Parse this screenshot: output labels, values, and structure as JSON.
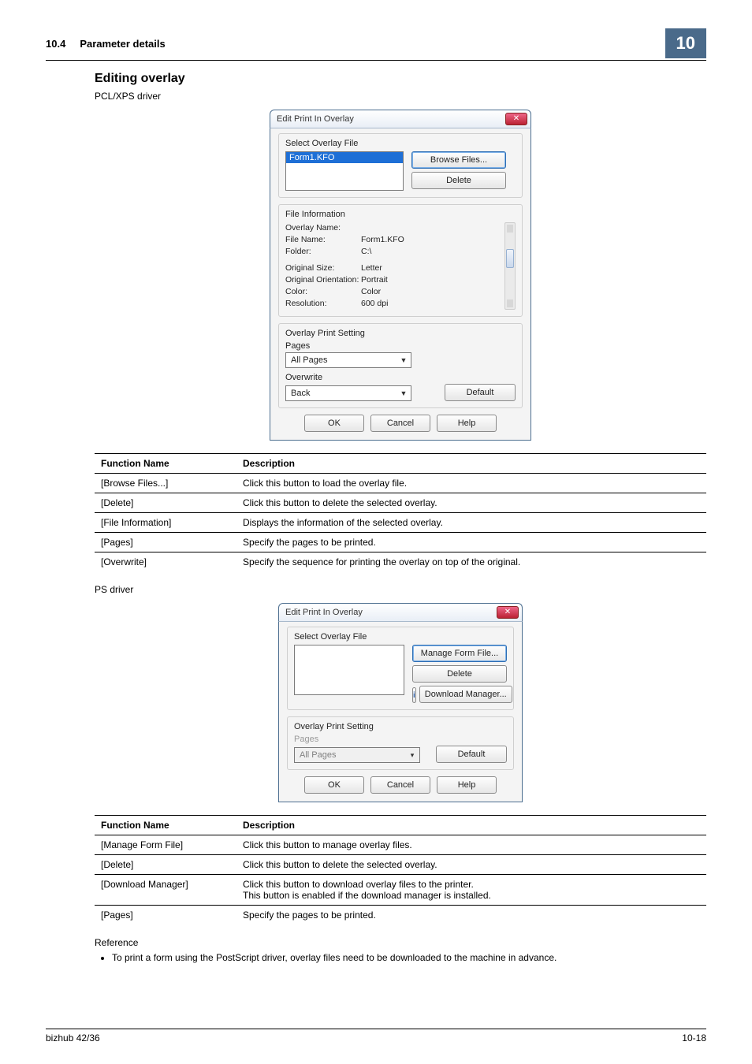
{
  "header": {
    "section_number": "10.4",
    "section_title": "Parameter details",
    "chapter": "10"
  },
  "editing": {
    "heading": "Editing overlay",
    "driver_pcl": "PCL/XPS driver",
    "driver_ps": "PS driver"
  },
  "dialog1": {
    "title": "Edit Print In Overlay",
    "select_label": "Select Overlay File",
    "selected_item": "Form1.KFO",
    "btn_browse": "Browse Files...",
    "btn_delete": "Delete",
    "file_info_label": "File Information",
    "kv": {
      "overlay_name_k": "Overlay Name:",
      "overlay_name_v": "",
      "file_name_k": "File Name:",
      "file_name_v": "Form1.KFO",
      "folder_k": "Folder:",
      "folder_v": "C:\\",
      "orig_size_k": "Original Size:",
      "orig_size_v": "Letter",
      "orig_orient_k": "Original Orientation:",
      "orig_orient_v": "Portrait",
      "color_k": "Color:",
      "color_v": "Color",
      "resolution_k": "Resolution:",
      "resolution_v": "600 dpi"
    },
    "ops_label": "Overlay Print Setting",
    "pages_label": "Pages",
    "pages_value": "All Pages",
    "overwrite_label": "Overwrite",
    "overwrite_value": "Back",
    "btn_default": "Default",
    "btn_ok": "OK",
    "btn_cancel": "Cancel",
    "btn_help": "Help"
  },
  "table1": {
    "h1": "Function Name",
    "h2": "Description",
    "rows": [
      {
        "f": "[Browse Files...]",
        "d": "Click this button to load the overlay file."
      },
      {
        "f": "[Delete]",
        "d": "Click this button to delete the selected overlay."
      },
      {
        "f": "[File Information]",
        "d": "Displays the information of the selected overlay."
      },
      {
        "f": "[Pages]",
        "d": "Specify the pages to be printed."
      },
      {
        "f": "[Overwrite]",
        "d": "Specify the sequence for printing the overlay on top of the original."
      }
    ]
  },
  "dialog2": {
    "title": "Edit Print In Overlay",
    "select_label": "Select Overlay File",
    "btn_manage": "Manage Form File...",
    "btn_delete": "Delete",
    "btn_download": "Download Manager...",
    "ops_label": "Overlay Print Setting",
    "pages_label": "Pages",
    "pages_value": "All Pages",
    "btn_default": "Default",
    "btn_ok": "OK",
    "btn_cancel": "Cancel",
    "btn_help": "Help"
  },
  "table2": {
    "h1": "Function Name",
    "h2": "Description",
    "rows": [
      {
        "f": "[Manage Form File]",
        "d": "Click this button to manage overlay files."
      },
      {
        "f": "[Delete]",
        "d": "Click this button to delete the selected overlay."
      },
      {
        "f": "[Download Manager]",
        "d": "Click this button to download overlay files to the printer.\nThis button is enabled if the download manager is installed."
      },
      {
        "f": "[Pages]",
        "d": "Specify the pages to be printed."
      }
    ]
  },
  "reference": {
    "heading": "Reference",
    "bullet": "To print a form using the PostScript driver, overlay files need to be downloaded to the machine in advance."
  },
  "footer": {
    "left": "bizhub 42/36",
    "right": "10-18"
  }
}
